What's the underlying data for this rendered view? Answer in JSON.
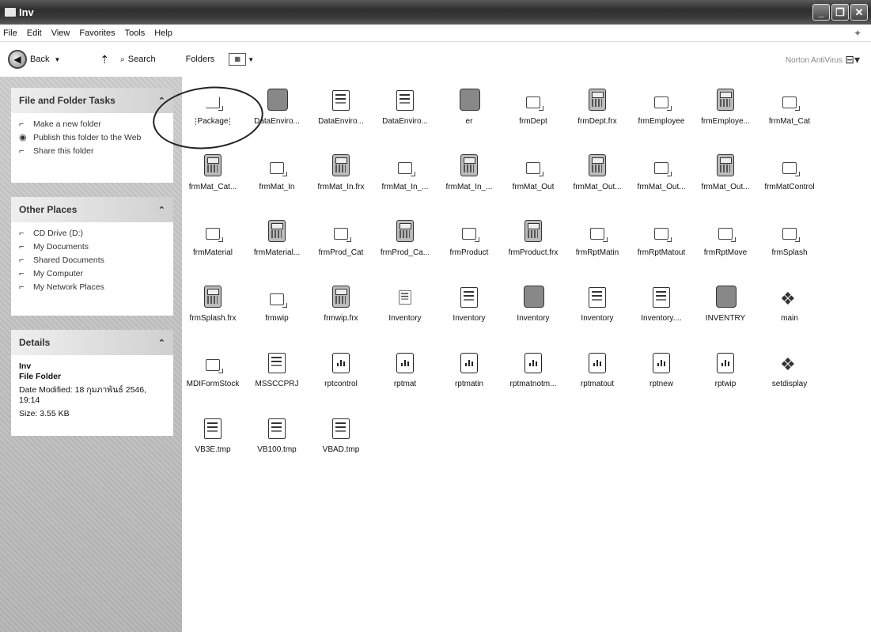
{
  "window": {
    "title": "Inv"
  },
  "menu": [
    "File",
    "Edit",
    "View",
    "Favorites",
    "Tools",
    "Help"
  ],
  "toolbar": {
    "back": "Back",
    "search": "Search",
    "folders": "Folders",
    "norton": "Norton AntiVirus"
  },
  "left_panel": {
    "file_tasks": {
      "title": "File and Folder Tasks",
      "items": [
        {
          "icon": "new-folder-icon",
          "label": "Make a new folder"
        },
        {
          "icon": "publish-web-icon",
          "label": "Publish this folder to the Web"
        },
        {
          "icon": "share-icon",
          "label": "Share this folder"
        }
      ]
    },
    "other_places": {
      "title": "Other Places",
      "items": [
        {
          "icon": "cd-drive-icon",
          "label": "CD Drive (D:)"
        },
        {
          "icon": "my-documents-icon",
          "label": "My Documents"
        },
        {
          "icon": "shared-documents-icon",
          "label": "Shared Documents"
        },
        {
          "icon": "my-computer-icon",
          "label": "My Computer"
        },
        {
          "icon": "network-places-icon",
          "label": "My Network Places"
        }
      ]
    },
    "details": {
      "title": "Details",
      "name": "Inv",
      "type": "File Folder",
      "modified": "Date Modified: 18 กุมภาพันธ์ 2546, 19:14",
      "size": "Size: 3.55 KB"
    }
  },
  "files": [
    {
      "name": "Package",
      "kind": "folder-open",
      "selected": true
    },
    {
      "name": "DataEnviro...",
      "kind": "designer"
    },
    {
      "name": "DataEnviro...",
      "kind": "doc"
    },
    {
      "name": "DataEnviro...",
      "kind": "doc"
    },
    {
      "name": "er",
      "kind": "hand"
    },
    {
      "name": "frmDept",
      "kind": "folder"
    },
    {
      "name": "frmDept.frx",
      "kind": "form"
    },
    {
      "name": "frmEmployee",
      "kind": "folder"
    },
    {
      "name": "frmEmploye...",
      "kind": "form"
    },
    {
      "name": "frmMat_Cat",
      "kind": "folder"
    },
    {
      "name": "frmMat_Cat...",
      "kind": "form"
    },
    {
      "name": "frmMat_In",
      "kind": "folder"
    },
    {
      "name": "frmMat_In.frx",
      "kind": "form"
    },
    {
      "name": "frmMat_In_...",
      "kind": "folder"
    },
    {
      "name": "frmMat_In_...",
      "kind": "form"
    },
    {
      "name": "frmMat_Out",
      "kind": "folder"
    },
    {
      "name": "frmMat_Out...",
      "kind": "form"
    },
    {
      "name": "frmMat_Out...",
      "kind": "folder"
    },
    {
      "name": "frmMat_Out...",
      "kind": "form"
    },
    {
      "name": "frmMatControl",
      "kind": "folder"
    },
    {
      "name": "frmMaterial",
      "kind": "folder"
    },
    {
      "name": "frmMaterial...",
      "kind": "form"
    },
    {
      "name": "frmProd_Cat",
      "kind": "folder"
    },
    {
      "name": "frmProd_Ca...",
      "kind": "form"
    },
    {
      "name": "frmProduct",
      "kind": "folder"
    },
    {
      "name": "frmProduct.frx",
      "kind": "form"
    },
    {
      "name": "frmRptMatin",
      "kind": "folder"
    },
    {
      "name": "frmRptMatout",
      "kind": "folder"
    },
    {
      "name": "frmRptMove",
      "kind": "folder"
    },
    {
      "name": "frmSplash",
      "kind": "folder"
    },
    {
      "name": "frmSplash.frx",
      "kind": "form"
    },
    {
      "name": "frmwip",
      "kind": "folder"
    },
    {
      "name": "frmwip.frx",
      "kind": "form"
    },
    {
      "name": "Inventory",
      "kind": "doc-small"
    },
    {
      "name": "Inventory",
      "kind": "doc"
    },
    {
      "name": "Inventory",
      "kind": "project"
    },
    {
      "name": "Inventory",
      "kind": "doc"
    },
    {
      "name": "Inventory....",
      "kind": "doc"
    },
    {
      "name": "INVENTRY",
      "kind": "hand"
    },
    {
      "name": "main",
      "kind": "module"
    },
    {
      "name": "MDIFormStock",
      "kind": "folder"
    },
    {
      "name": "MSSCCPRJ",
      "kind": "doc"
    },
    {
      "name": "rptcontrol",
      "kind": "report"
    },
    {
      "name": "rptmat",
      "kind": "report"
    },
    {
      "name": "rptmatin",
      "kind": "report"
    },
    {
      "name": "rptmatnotm...",
      "kind": "report"
    },
    {
      "name": "rptmatout",
      "kind": "report"
    },
    {
      "name": "rptnew",
      "kind": "report"
    },
    {
      "name": "rptwip",
      "kind": "report"
    },
    {
      "name": "setdisplay",
      "kind": "module"
    },
    {
      "name": "VB3E.tmp",
      "kind": "doc"
    },
    {
      "name": "VB100.tmp",
      "kind": "doc"
    },
    {
      "name": "VBAD.tmp",
      "kind": "doc"
    }
  ]
}
